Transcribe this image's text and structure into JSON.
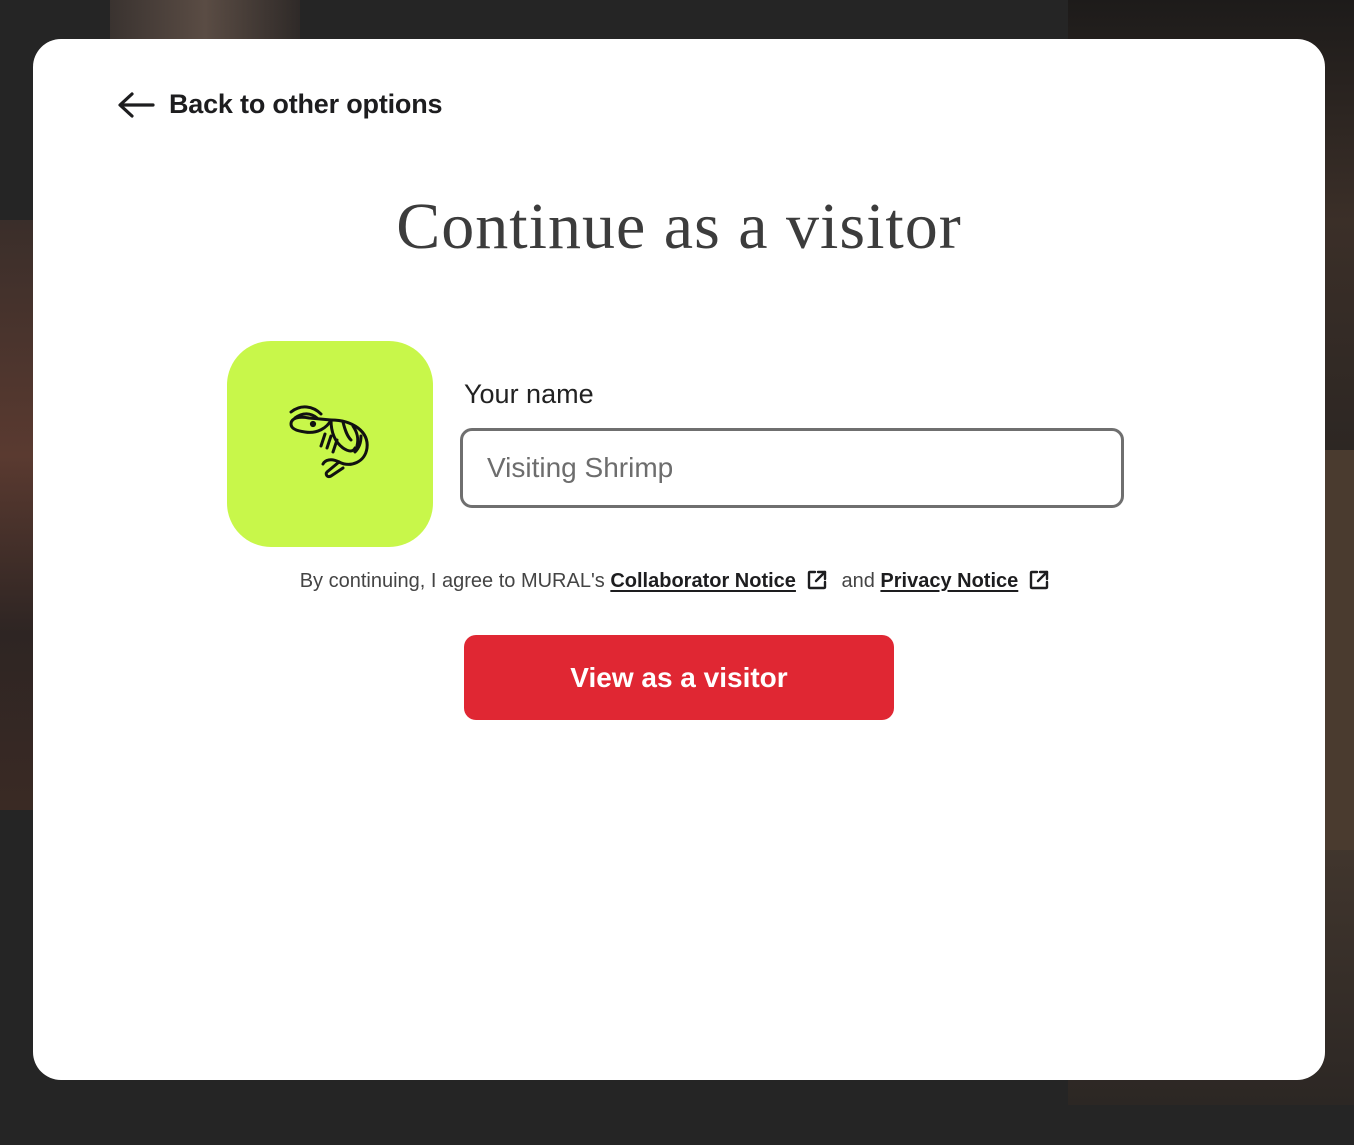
{
  "modal": {
    "back_link_label": "Back to other options",
    "title": "Continue as a visitor",
    "avatar_icon": "shrimp-icon",
    "avatar_color": "#c8f74a",
    "name_field": {
      "label": "Your name",
      "value": "",
      "placeholder": "Visiting Shrimp"
    },
    "terms": {
      "prefix": "By continuing, I agree to MURAL's",
      "collaborator_link": "Collaborator Notice",
      "conjunction": "and",
      "privacy_link": "Privacy Notice",
      "link_icon": "external-link-icon"
    },
    "primary_button_label": "View as a visitor",
    "primary_button_color": "#e02733"
  }
}
